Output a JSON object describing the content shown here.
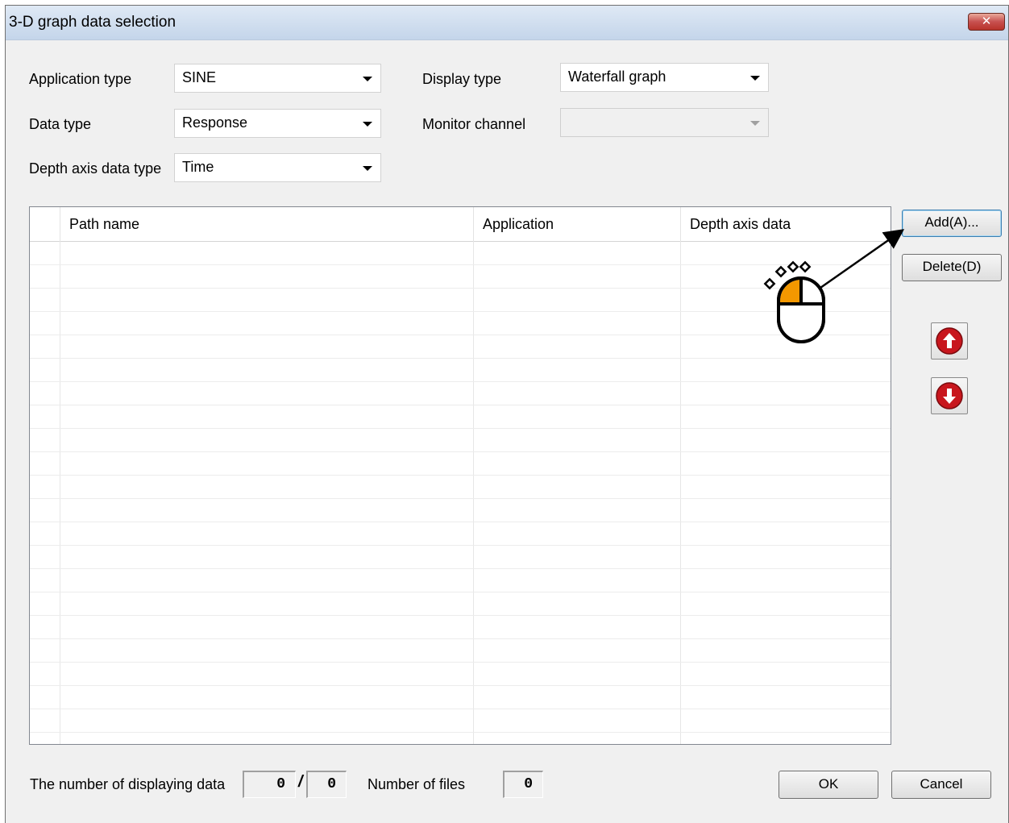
{
  "window": {
    "title": "3-D graph data selection",
    "close_glyph": "✕"
  },
  "form": {
    "application_type": {
      "label": "Application type",
      "value": "SINE"
    },
    "data_type": {
      "label": "Data type",
      "value": "Response"
    },
    "depth_axis_data_type": {
      "label": "Depth axis data type",
      "value": "Time"
    },
    "display_type": {
      "label": "Display type",
      "value": "Waterfall graph"
    },
    "monitor_channel": {
      "label": "Monitor channel",
      "value": ""
    }
  },
  "grid": {
    "columns": [
      "Path name",
      "Application",
      "Depth axis data"
    ],
    "rows": []
  },
  "side_buttons": {
    "add_label": "Add(A)...",
    "delete_label": "Delete(D)",
    "move_up_icon": "arrow-up-circle-icon",
    "move_down_icon": "arrow-down-circle-icon"
  },
  "footer": {
    "displaying_label": "The number of displaying data",
    "displaying_current": "0",
    "separator": "/",
    "displaying_total": "0",
    "files_label": "Number of files",
    "files_count": "0",
    "ok_label": "OK",
    "cancel_label": "Cancel"
  },
  "colors": {
    "accent_red": "#c8161d",
    "mouse_highlight": "#f39800",
    "title_gradient_top": "#dfe9f5"
  }
}
